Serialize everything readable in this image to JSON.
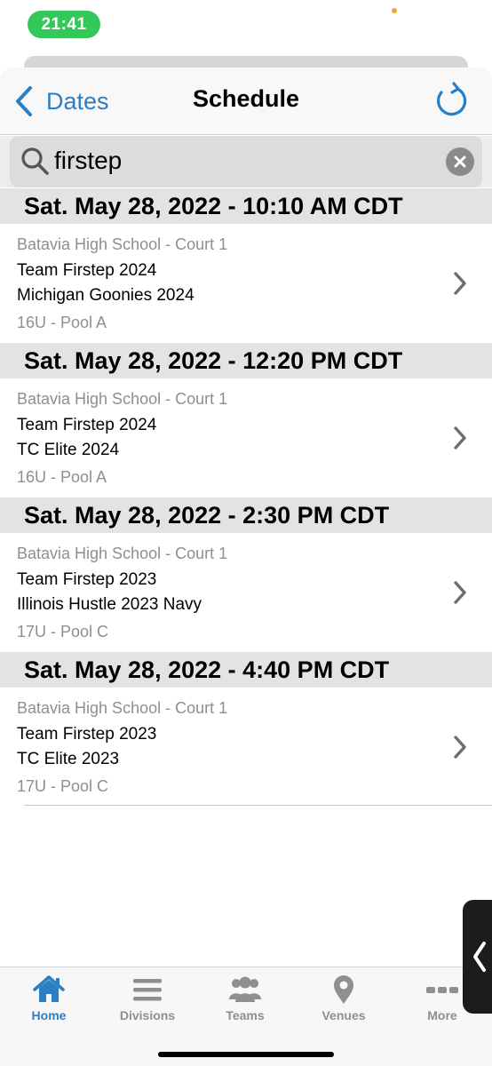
{
  "status": {
    "time": "21:41"
  },
  "nav": {
    "back_label": "Dates",
    "title": "Schedule",
    "refresh_icon": "refresh-icon"
  },
  "search": {
    "value": "firstep",
    "placeholder": ""
  },
  "colors": {
    "accent": "#2a7fc4",
    "section_bg": "#e3e3e6",
    "time_pill": "#34c759"
  },
  "sections": [
    {
      "header": "Sat. May 28, 2022 - 10:10 AM CDT",
      "venue": "Batavia High School - Court 1",
      "team1": "Team Firstep 2024",
      "team2": "Michigan Goonies 2024",
      "division": "16U - Pool A"
    },
    {
      "header": "Sat. May 28, 2022 - 12:20 PM CDT",
      "venue": "Batavia High School - Court 1",
      "team1": "Team Firstep 2024",
      "team2": "TC Elite 2024",
      "division": "16U - Pool A"
    },
    {
      "header": "Sat. May 28, 2022 - 2:30 PM CDT",
      "venue": "Batavia High School - Court 1",
      "team1": "Team Firstep 2023",
      "team2": "Illinois Hustle 2023 Navy",
      "division": "17U - Pool C"
    },
    {
      "header": "Sat. May 28, 2022 - 4:40 PM CDT",
      "venue": "Batavia High School - Court 1",
      "team1": "Team Firstep 2023",
      "team2": "TC Elite 2023",
      "division": "17U - Pool C"
    }
  ],
  "tabs": [
    {
      "label": "Home",
      "icon": "home-icon",
      "active": true
    },
    {
      "label": "Divisions",
      "icon": "list-icon",
      "active": false
    },
    {
      "label": "Teams",
      "icon": "people-icon",
      "active": false
    },
    {
      "label": "Venues",
      "icon": "location-pin-icon",
      "active": false
    },
    {
      "label": "More",
      "icon": "more-icon",
      "active": false
    }
  ]
}
